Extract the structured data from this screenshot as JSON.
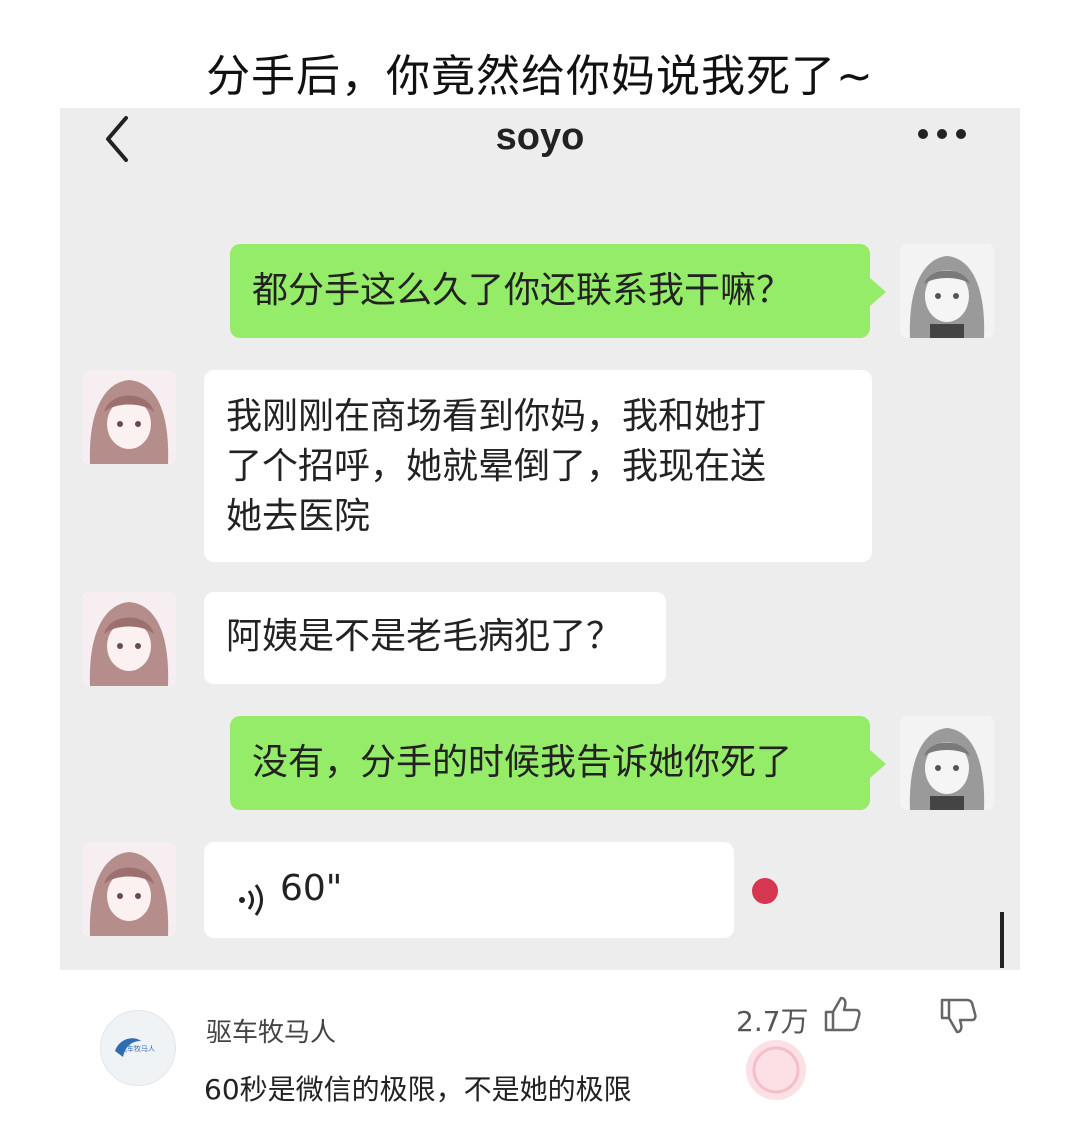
{
  "headline": "分手后，你竟然给你妈说我死了~",
  "chat": {
    "title": "soyo",
    "messages": [
      {
        "side": "right",
        "text": "都分手这么久了你还联系我干嘛？"
      },
      {
        "side": "left",
        "lines": [
          "我刚刚在商场看到你妈，我和她打",
          "了个招呼，她就晕倒了，我现在送",
          "她去医院"
        ]
      },
      {
        "side": "left",
        "text": "阿姨是不是老毛病犯了？"
      },
      {
        "side": "right",
        "text": "没有，分手的时候我告诉她你死了"
      },
      {
        "side": "left",
        "type": "voice",
        "duration": "60\""
      }
    ]
  },
  "comment": {
    "user": "驱车牧马人",
    "avatar_text": "驱车牧马人",
    "text": "60秒是微信的极限，不是她的极限",
    "likes": "2.7万"
  },
  "colors": {
    "green_bubble": "#95ec69",
    "chat_background": "#ededed",
    "unread_dot": "#d6364f"
  },
  "icons": [
    "back-arrow-icon",
    "more-dots-icon",
    "voice-wave-icon",
    "like-icon",
    "dislike-icon"
  ]
}
